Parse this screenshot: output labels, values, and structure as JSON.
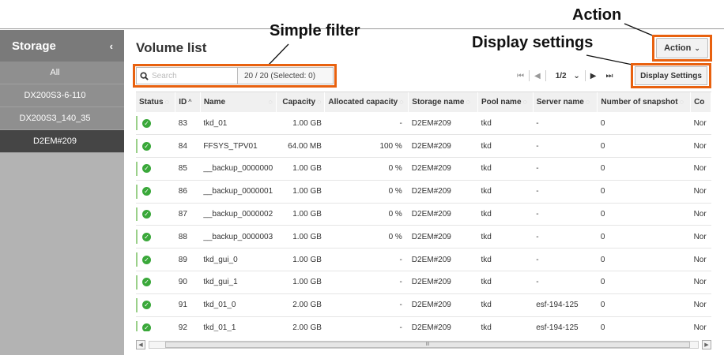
{
  "annotations": {
    "simple_filter": "Simple filter",
    "display_settings": "Display settings",
    "action": "Action"
  },
  "sidebar": {
    "title": "Storage",
    "collapse_icon": "chevron-left-icon",
    "items": [
      {
        "label": "All"
      },
      {
        "label": "DX200S3-6-110"
      },
      {
        "label": "DX200S3_140_35"
      },
      {
        "label": "D2EM#209"
      }
    ],
    "active_index": 3
  },
  "main": {
    "title": "Volume list",
    "action_button": "Action",
    "display_settings_button": "Display Settings",
    "search": {
      "placeholder": "Search",
      "value": ""
    },
    "count_text": "20 / 20 (Selected: 0)",
    "pager": {
      "first": "⏮",
      "prev": "◀",
      "page": "1/2",
      "next": "▶",
      "last": "⏭"
    },
    "colors": {
      "accent": "#e8610f",
      "status_ok": "#3aa83a"
    }
  },
  "table": {
    "columns": [
      "Status",
      "ID",
      "Name",
      "Capacity",
      "Allocated capacity",
      "Storage name",
      "Pool name",
      "Server name",
      "Number of snapshot",
      "Co"
    ],
    "sorted_column": "ID",
    "rows": [
      {
        "id": "83",
        "name": "tkd_01",
        "capacity": "1.00 GB",
        "allocated": "-",
        "storage": "D2EM#209",
        "pool": "tkd",
        "server": "-",
        "snapshots": "0",
        "copy": "Nor"
      },
      {
        "id": "84",
        "name": "FFSYS_TPV01",
        "capacity": "64.00 MB",
        "allocated": "100 %",
        "storage": "D2EM#209",
        "pool": "tkd",
        "server": "-",
        "snapshots": "0",
        "copy": "Nor"
      },
      {
        "id": "85",
        "name": "__backup_0000000",
        "capacity": "1.00 GB",
        "allocated": "0 %",
        "storage": "D2EM#209",
        "pool": "tkd",
        "server": "-",
        "snapshots": "0",
        "copy": "Nor"
      },
      {
        "id": "86",
        "name": "__backup_0000001",
        "capacity": "1.00 GB",
        "allocated": "0 %",
        "storage": "D2EM#209",
        "pool": "tkd",
        "server": "-",
        "snapshots": "0",
        "copy": "Nor"
      },
      {
        "id": "87",
        "name": "__backup_0000002",
        "capacity": "1.00 GB",
        "allocated": "0 %",
        "storage": "D2EM#209",
        "pool": "tkd",
        "server": "-",
        "snapshots": "0",
        "copy": "Nor"
      },
      {
        "id": "88",
        "name": "__backup_0000003",
        "capacity": "1.00 GB",
        "allocated": "0 %",
        "storage": "D2EM#209",
        "pool": "tkd",
        "server": "-",
        "snapshots": "0",
        "copy": "Nor"
      },
      {
        "id": "89",
        "name": "tkd_gui_0",
        "capacity": "1.00 GB",
        "allocated": "-",
        "storage": "D2EM#209",
        "pool": "tkd",
        "server": "-",
        "snapshots": "0",
        "copy": "Nor"
      },
      {
        "id": "90",
        "name": "tkd_gui_1",
        "capacity": "1.00 GB",
        "allocated": "-",
        "storage": "D2EM#209",
        "pool": "tkd",
        "server": "-",
        "snapshots": "0",
        "copy": "Nor"
      },
      {
        "id": "91",
        "name": "tkd_01_0",
        "capacity": "2.00 GB",
        "allocated": "-",
        "storage": "D2EM#209",
        "pool": "tkd",
        "server": "esf-194-125",
        "snapshots": "0",
        "copy": "Nor"
      },
      {
        "id": "92",
        "name": "tkd_01_1",
        "capacity": "2.00 GB",
        "allocated": "-",
        "storage": "D2EM#209",
        "pool": "tkd",
        "server": "esf-194-125",
        "snapshots": "0",
        "copy": "Nor"
      }
    ]
  },
  "scrollbar": {
    "left_icon": "arrow-left-icon",
    "right_icon": "arrow-right-icon",
    "grip": "III"
  }
}
